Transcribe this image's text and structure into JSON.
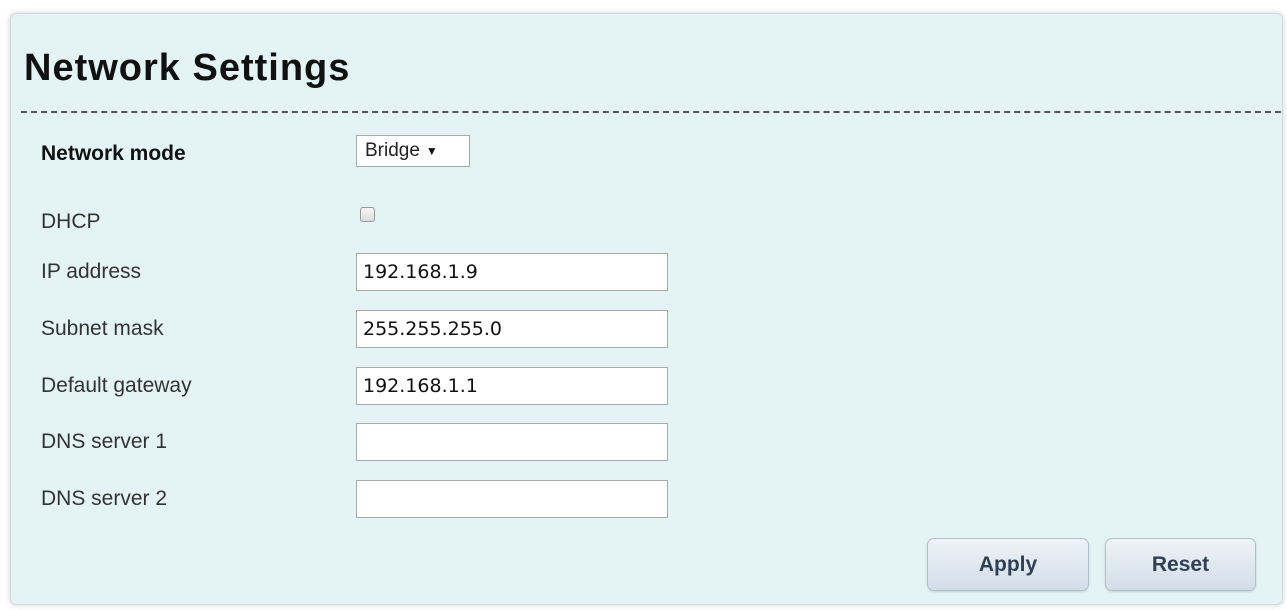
{
  "page": {
    "title": "Network Settings"
  },
  "form": {
    "network_mode": {
      "label": "Network mode",
      "selected": "Bridge"
    },
    "dhcp": {
      "label": "DHCP",
      "checked": false
    },
    "ip_address": {
      "label": "IP address",
      "value": "192.168.1.9"
    },
    "subnet_mask": {
      "label": "Subnet mask",
      "value": "255.255.255.0"
    },
    "default_gateway": {
      "label": "Default gateway",
      "value": "192.168.1.1"
    },
    "dns_server_1": {
      "label": "DNS server 1",
      "value": ""
    },
    "dns_server_2": {
      "label": "DNS server 2",
      "value": ""
    }
  },
  "actions": {
    "apply_label": "Apply",
    "reset_label": "Reset"
  },
  "icons": {
    "select_arrow": "caret-down-icon"
  },
  "colors": {
    "panel_background": "#e4f3f4",
    "button_text": "#2f3f55"
  }
}
